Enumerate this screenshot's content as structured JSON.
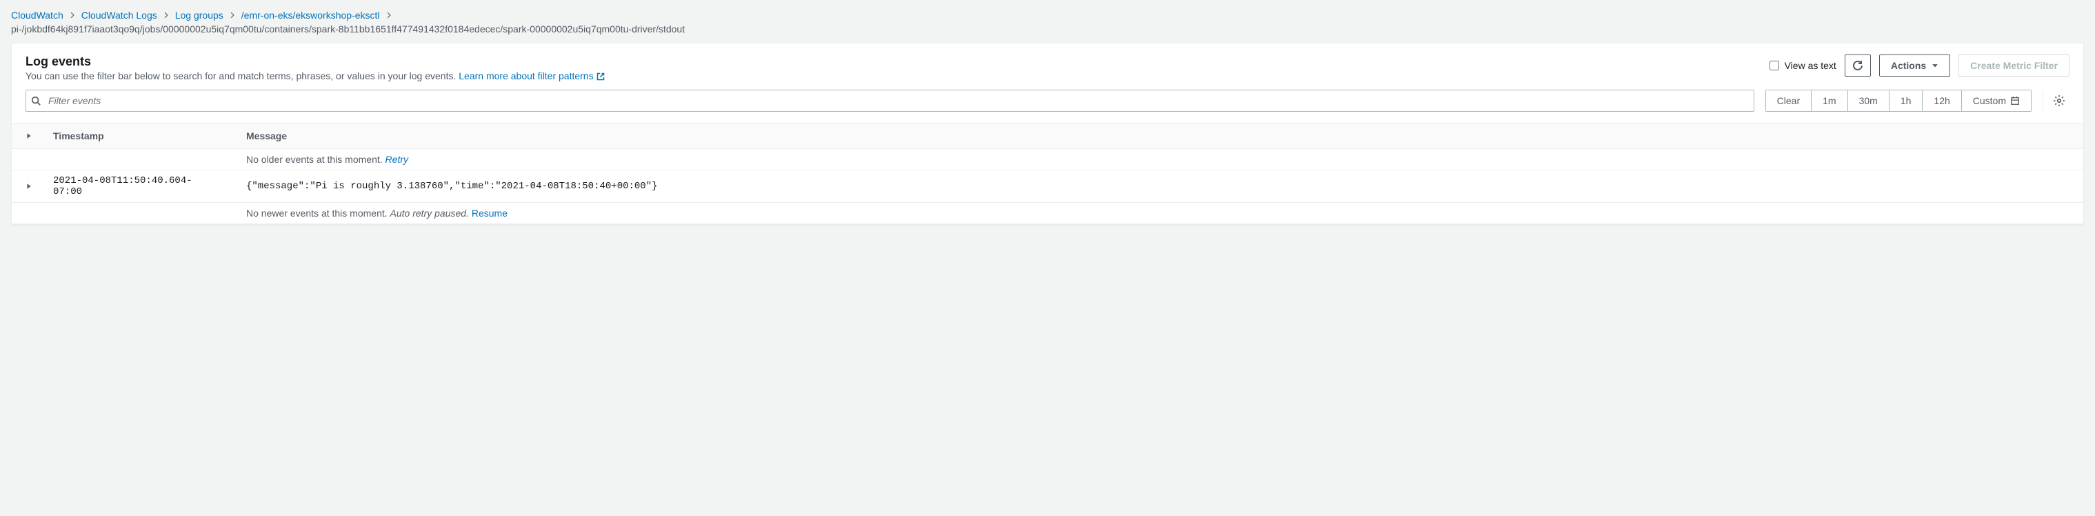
{
  "breadcrumb": {
    "items": [
      {
        "label": "CloudWatch"
      },
      {
        "label": "CloudWatch Logs"
      },
      {
        "label": "Log groups"
      },
      {
        "label": "/emr-on-eks/eksworkshop-eksctl"
      }
    ],
    "current": "pi-/jokbdf64kj891f7iaaot3qo9q/jobs/00000002u5iq7qm00tu/containers/spark-8b11bb1651ff477491432f0184edecec/spark-00000002u5iq7qm00tu-driver/stdout"
  },
  "header": {
    "title": "Log events",
    "description": "You can use the filter bar below to search for and match terms, phrases, or values in your log events. ",
    "learn_more": "Learn more about filter patterns",
    "view_as_text": "View as text",
    "actions": "Actions",
    "create_filter": "Create Metric Filter"
  },
  "filter": {
    "placeholder": "Filter events",
    "clear": "Clear",
    "ranges": [
      "1m",
      "30m",
      "1h",
      "12h"
    ],
    "custom": "Custom"
  },
  "table": {
    "columns": {
      "timestamp": "Timestamp",
      "message": "Message"
    },
    "no_older": "No older events at this moment. ",
    "retry": "Retry",
    "rows": [
      {
        "timestamp": "2021-04-08T11:50:40.604-07:00",
        "message": "{\"message\":\"Pi is roughly 3.138760\",\"time\":\"2021-04-08T18:50:40+00:00\"}"
      }
    ],
    "no_newer": "No newer events at this moment. ",
    "auto_retry": "Auto retry paused. ",
    "resume": "Resume"
  }
}
